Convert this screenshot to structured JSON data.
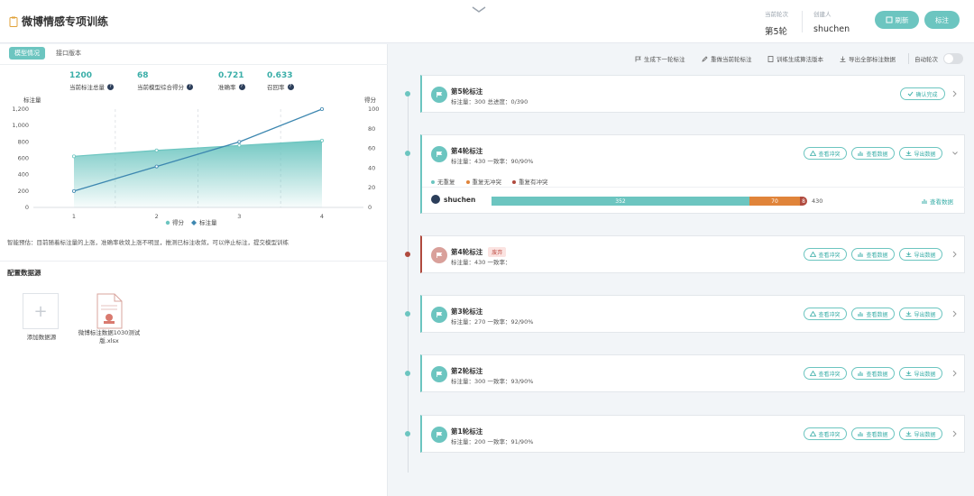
{
  "header": {
    "title": "微博情感专项训练",
    "current_round_label": "当前轮次",
    "current_round_value": "第5轮",
    "creator_label": "创建人",
    "creator_value": "shuchen",
    "refresh_label": "刷新",
    "annotate_label": "标注"
  },
  "left": {
    "tabs": [
      {
        "label": "模型情况",
        "active": true
      },
      {
        "label": "接口版本",
        "active": false
      }
    ],
    "stats": [
      {
        "value": "1200",
        "label": "当前标注总量"
      },
      {
        "value": "68",
        "label": "当前模型综合得分"
      },
      {
        "value": "0.721",
        "label": "准确率"
      },
      {
        "value": "0.633",
        "label": "召回率"
      }
    ],
    "prediction": "智能预估：目前随着标注量的上涨，准确率收敛上涨不明显，推测已标注收敛，可以停止标注，提交模型训练",
    "datasource_title": "配置数据源",
    "add_datasource_label": "添加数据源",
    "file_name": "微博标注数据1030测试版.xlsx"
  },
  "chart_data": {
    "type": "line",
    "x": [
      1,
      2,
      3,
      4
    ],
    "series": [
      {
        "name": "得分",
        "values": [
          52,
          58,
          63,
          68
        ],
        "axis": "right",
        "style": "area",
        "color": "#6cc5c0"
      },
      {
        "name": "标注量",
        "values": [
          200,
          500,
          800,
          1200
        ],
        "axis": "left",
        "style": "line",
        "color": "#3d87b0"
      }
    ],
    "ylabel_left": "标注量",
    "ylabel_right": "得分",
    "ylim_left": [
      0,
      1200
    ],
    "yticks_left": [
      "0",
      "200",
      "400",
      "600",
      "800",
      "1,000",
      "1,200"
    ],
    "ylim_right": [
      0,
      100
    ],
    "yticks_right": [
      "0",
      "20",
      "40",
      "60",
      "80",
      "100"
    ],
    "xticks": [
      "1",
      "2",
      "3",
      "4"
    ],
    "legend": [
      "得分",
      "标注量"
    ],
    "legend_position": "bottom"
  },
  "toolbar": {
    "items": [
      "生成下一轮标注",
      "重做当前轮标注",
      "训练生成算法版本",
      "导出全部标注数据"
    ],
    "auto_round_label": "自动轮次"
  },
  "cards": [
    {
      "title": "第5轮标注",
      "sub": "标注量：300    总进度：0/390",
      "status": "normal",
      "confirm_label": "确认完成"
    },
    {
      "title": "第4轮标注",
      "sub": "标注量：430    一致率：90/90%",
      "status": "normal",
      "expanded": true,
      "legend": [
        "无重复",
        "重复无冲突",
        "重复有冲突"
      ],
      "user": "shuchen",
      "bar_values": [
        "352",
        "70",
        "8"
      ],
      "bar_total": "430",
      "bar_view_label": "查看数据"
    },
    {
      "title": "第4轮标注",
      "badge": "废弃",
      "sub": "标注量：430    一致率：",
      "status": "abandoned"
    },
    {
      "title": "第3轮标注",
      "sub": "标注量：270    一致率：92/90%",
      "status": "normal"
    },
    {
      "title": "第2轮标注",
      "sub": "标注量：300    一致率：93/90%",
      "status": "normal"
    },
    {
      "title": "第1轮标注",
      "sub": "标注量：200    一致率：91/90%",
      "status": "normal"
    }
  ],
  "card_actions": {
    "conflict": "查看冲突",
    "data": "查看数据",
    "export": "导出数据"
  },
  "colors": {
    "accent": "#6cc5c0",
    "accent_dark": "#3aaea8",
    "line": "#3d87b0",
    "orange": "#e0843a",
    "red": "#b04a3e"
  }
}
